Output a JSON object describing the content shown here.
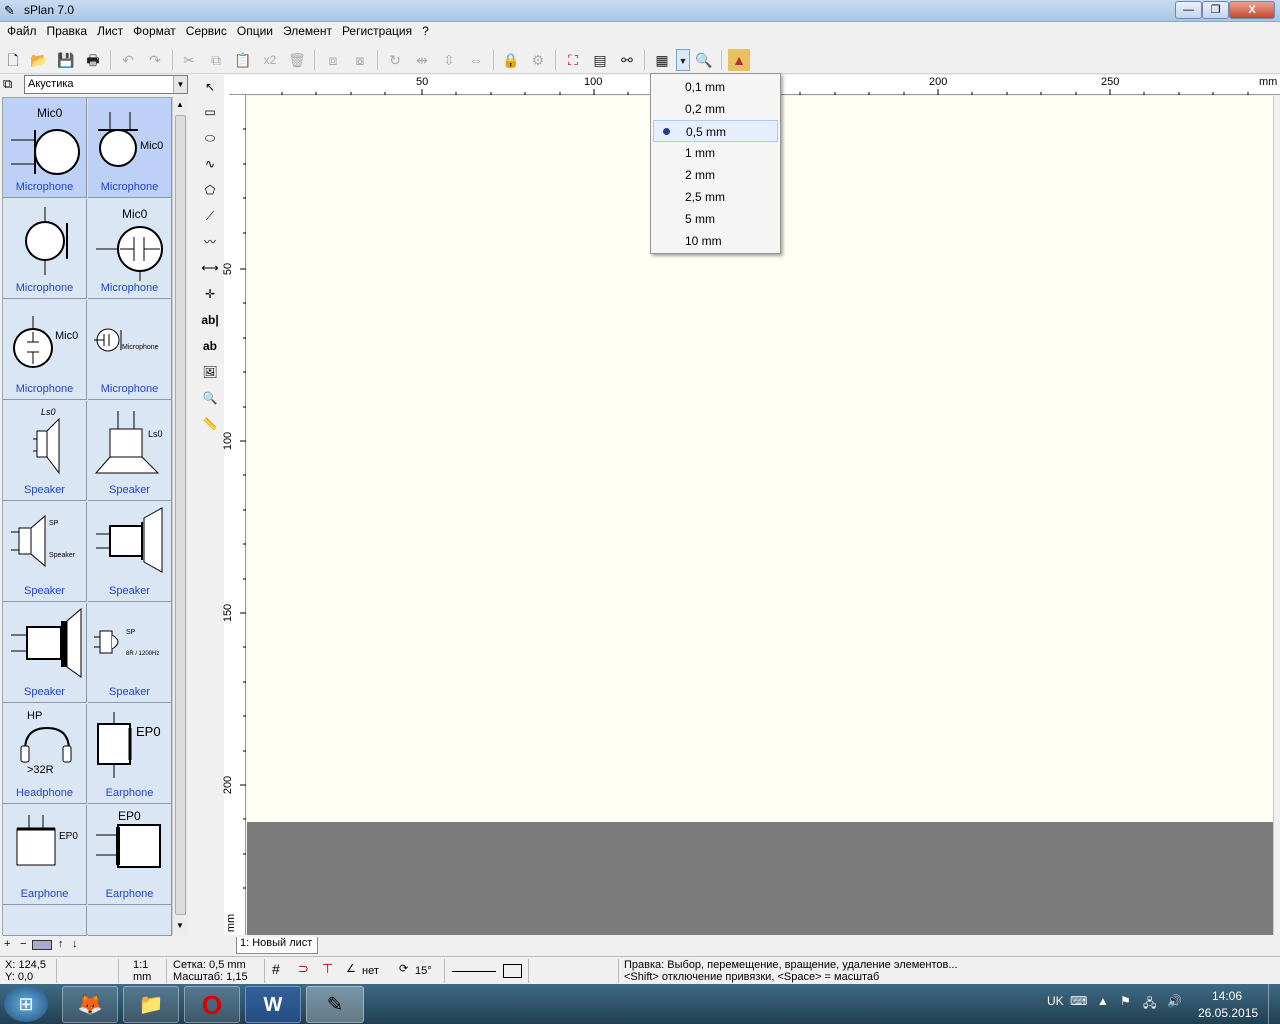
{
  "window": {
    "title": "sPlan 7.0",
    "min": "—",
    "max": "❐",
    "close": "X"
  },
  "menu": [
    "Файл",
    "Правка",
    "Лист",
    "Формат",
    "Сервис",
    "Опции",
    "Элемент",
    "Регистрация",
    "?"
  ],
  "toolbar": {
    "x2": "x2"
  },
  "library": {
    "selected": "Акустика",
    "items": [
      {
        "label": "Microphone",
        "ref": "Mic0"
      },
      {
        "label": "Microphone",
        "ref": "Mic0"
      },
      {
        "label": "Microphone",
        "ref": ""
      },
      {
        "label": "Microphone",
        "ref": "Mic0"
      },
      {
        "label": "Microphone",
        "ref": "Mic0"
      },
      {
        "label": "Microphone",
        "ref": "Microphone"
      },
      {
        "label": "Speaker",
        "ref": "Ls0"
      },
      {
        "label": "Speaker",
        "ref": "Ls0"
      },
      {
        "label": "Speaker",
        "ref": "SP",
        "sub": "Speaker"
      },
      {
        "label": "Speaker",
        "ref": ""
      },
      {
        "label": "Speaker",
        "ref": ""
      },
      {
        "label": "Speaker",
        "ref": "SP",
        "sub": "8R / 1200Hz"
      },
      {
        "label": "Headphone",
        "ref": "HP",
        "sub": ">32R"
      },
      {
        "label": "Earphone",
        "ref": "EP0"
      },
      {
        "label": "Earphone",
        "ref": "EP0"
      },
      {
        "label": "Earphone",
        "ref": "EP0"
      }
    ]
  },
  "ruler": {
    "top": [
      "50",
      "100",
      "200",
      "250",
      "mm"
    ],
    "left": [
      "50",
      "100",
      "150",
      "200",
      "mm"
    ]
  },
  "sheet_tab": "1: Новый лист",
  "grid_menu": {
    "options": [
      "0,1 mm",
      "0,2 mm",
      "0,5 mm",
      "1 mm",
      "2 mm",
      "2,5 mm",
      "5 mm",
      "10 mm"
    ],
    "selected": "0,5 mm"
  },
  "status": {
    "x": "X: 124,5",
    "y": "Y: 0,0",
    "scale_top": "1:1",
    "scale_unit": "mm",
    "grid": "Сетка: 0,5 mm",
    "zoom": "Масштаб:  1,15",
    "angle_mode": "нет",
    "angle": "15°",
    "hint1": "Правка: Выбор, перемещение, вращение, удаление элементов...",
    "hint2": "<Shift> отключение привязки, <Space> = масштаб"
  },
  "taskbar": {
    "lang": "UK",
    "time": "14:06",
    "date": "26.05.2015"
  }
}
